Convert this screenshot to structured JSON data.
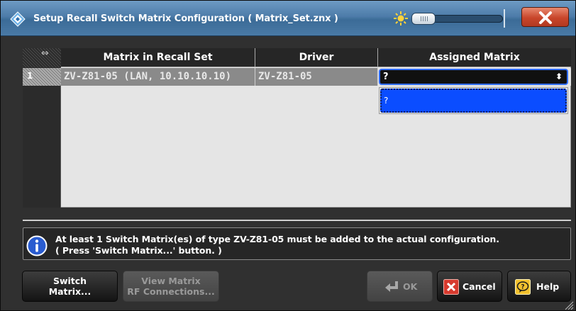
{
  "window": {
    "title": "Setup Recall Switch Matrix Configuration  ( Matrix_Set.znx )",
    "icons": [
      "rs-diamond-icon",
      "brightness-sun-icon",
      "close-icon"
    ]
  },
  "table": {
    "headers": [
      "Matrix in Recall Set",
      "Driver",
      "Assigned Matrix"
    ],
    "rows": [
      {
        "index": "1",
        "matrix": "ZV-Z81-05 (LAN, 10.10.10.10)",
        "driver": "ZV-Z81-05",
        "assigned": "?"
      }
    ],
    "dropdown_options": [
      "?"
    ]
  },
  "info": {
    "line1": "At least 1 Switch Matrix(es) of type ZV-Z81-05 must be added to the actual configuration.",
    "line2": "( Press 'Switch Matrix...' button. )"
  },
  "buttons": {
    "switch_matrix_line1": "Switch",
    "switch_matrix_line2": "Matrix...",
    "view_rf_line1": "View Matrix",
    "view_rf_line2": "RF Connections...",
    "ok": "OK",
    "cancel": "Cancel",
    "help": "Help"
  },
  "colors": {
    "accent_blue": "#0b4dff",
    "title_bar": "#4d7ca9",
    "close_red": "#c8452a"
  }
}
